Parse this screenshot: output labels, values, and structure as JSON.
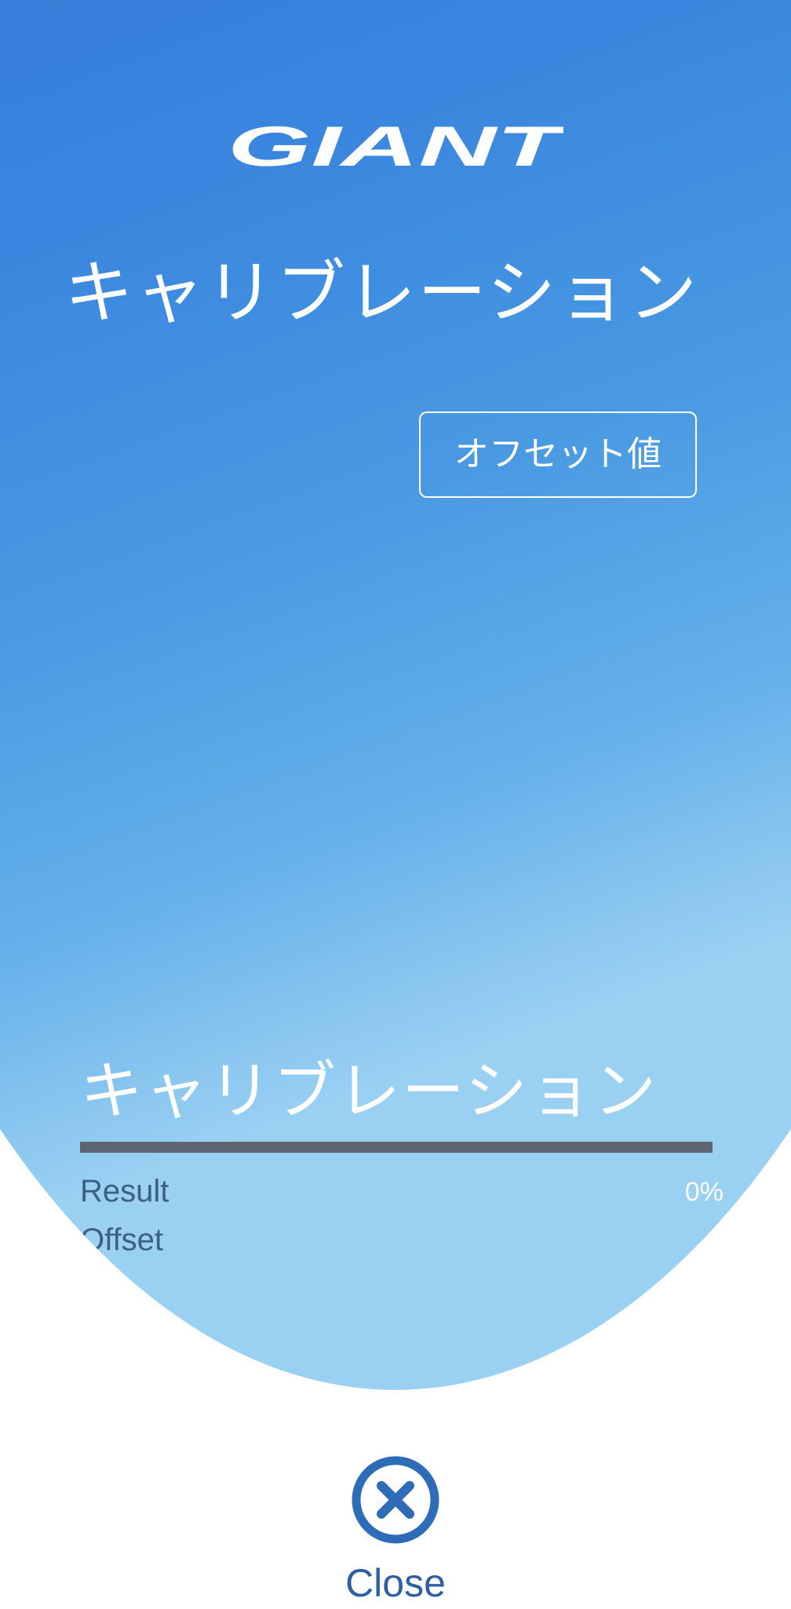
{
  "brand": {
    "logo_text": "GIANT"
  },
  "header": {
    "title": "キャリブレーション"
  },
  "actions": {
    "offset_button_label": "オフセット値"
  },
  "calibration": {
    "title": "キャリブレーション",
    "progress_percent": 0,
    "progress_text": "0%",
    "result_label": "Result",
    "offset_label": "Offset"
  },
  "footer": {
    "close_label": "Close"
  },
  "colors": {
    "gradient_top": "#2a5ba6",
    "gradient_mid": "#3a86de",
    "gradient_bottom": "#9ad0f2",
    "progress_track": "#5e6470",
    "label_color": "#3c5f86",
    "close_color": "#2e5fa3"
  },
  "icons": {
    "close": "close-circle-icon"
  }
}
